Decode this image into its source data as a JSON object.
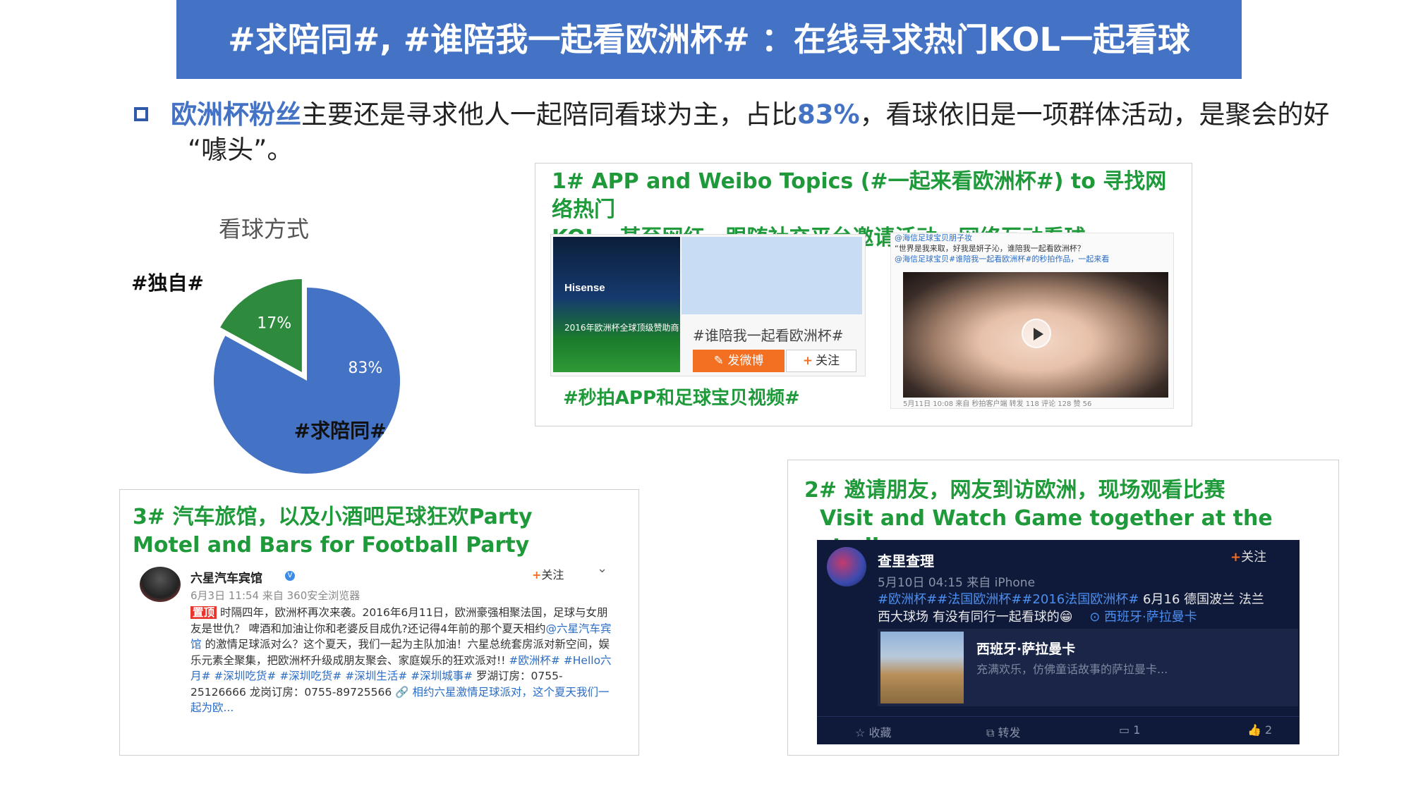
{
  "title": "#求陪同#, #谁陪我一起看欧洲杯# ：在线寻求热门KOL一起看球",
  "bullet": {
    "highlight_1": "欧洲杯粉丝",
    "text_1": "主要还是寻求他人一起陪同看球为主，占比",
    "highlight_2": "83%",
    "text_2": "，看球依旧是一项群体活动，是聚会的好",
    "text_3": "“噱头”。"
  },
  "chart_data": {
    "type": "pie",
    "title": "看球方式",
    "slices": [
      {
        "name": "#求陪同#",
        "value": 83,
        "label": "83%",
        "color": "#4472c4"
      },
      {
        "name": "#独自#",
        "value": 17,
        "label": "17%",
        "color": "#2e8b3e"
      }
    ]
  },
  "card1": {
    "title_line1": "1# APP and Weibo Topics (#一起来看欧洲杯#) to 寻找网络热门",
    "title_line2": "KOL，甚至网红，跟随社交平台邀请活动，网络互动看球",
    "topic": {
      "logo_brand": "Hisense",
      "logo_sub": "2016年欧洲杯全球顶级赞助商",
      "hashtag": "#谁陪我一起看欧洲杯#",
      "post_button": "发微博",
      "follow_button": "关注"
    },
    "video": {
      "header_line1": "@海信足球宝贝朋子妆",
      "header_line2": "“世界是我来取，好我是妍子沁，谁陪我一起看欧洲杯？",
      "header_line3": "@海信足球宝贝#谁陪我一起看欧洲杯#的秒拍作品，一起来看",
      "footer": "5月11日 10:08 来自 秒拍客户端      转发 118   评论 128   赞 56"
    },
    "caption": "#秒拍APP和足球宝贝视频#"
  },
  "card2": {
    "title_line1": "2# 邀请朋友，网友到访欧洲，现场观看比赛",
    "title_line2": "Visit and Watch Game together at the stadium",
    "post": {
      "name": "查里查理",
      "follow": "关注",
      "time": "5月10日 04:15 来自 iPhone",
      "tags": "#欧洲杯##法国欧洲杯##2016法国欧洲杯#",
      "text_1": "6月16 德国波兰 法兰",
      "text_2": "西大球场 有没有同行一起看球的😁",
      "location": "西班牙·萨拉曼卡",
      "card_title": "西班牙·萨拉曼卡",
      "card_desc": "充满欢乐，仿佛童话故事的萨拉曼卡...",
      "act_fav": "收藏",
      "act_repost": "转发",
      "act_comment": "1",
      "act_like": "2"
    }
  },
  "card3": {
    "title_line1": "3# 汽车旅馆，以及小酒吧足球狂欢Party",
    "title_line2": "Motel and Bars for Football Party",
    "post": {
      "name": "六星汽车宾馆",
      "follow": "关注",
      "time": "6月3日 11:54 来自 360安全浏览器",
      "tag": "置顶",
      "text_1": "时隔四年，欧洲杯再次来袭。2016年6月11日，欧洲豪强相聚法国，足球与女朋友是世仇？",
      "text_2": "啤酒和加油让你和老婆反目成仇?还记得4年前的那个夏天相约",
      "mention": "@六星汽车宾馆",
      "text_3": "的激情足球派对么？这个夏天，我们一起为主队加油！六星总统套房派对新空间，娱乐元素全聚集，把欧洲杯升级成朋友聚会、家庭娱乐的狂欢派对!!",
      "tags": "#欧洲杯# #Hello六月# #深圳吃货# #深圳吃货# #深圳生活# #深圳城事#",
      "text_4": "罗湖订房：0755-25126666 龙岗订房：0755-89725566",
      "link": "相约六星激情足球派对，这个夏天我们一起为欧..."
    }
  }
}
